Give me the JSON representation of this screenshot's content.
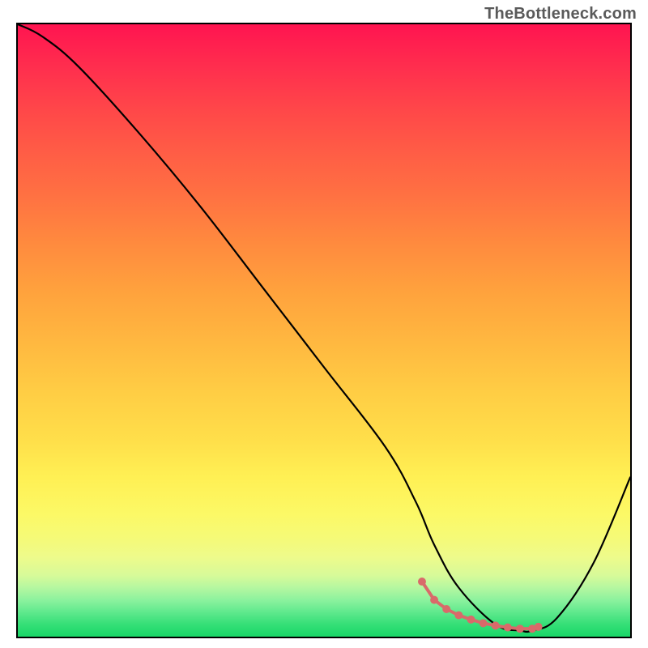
{
  "watermark": {
    "text": "TheBottleneck.com"
  },
  "chart_data": {
    "type": "line",
    "title": "",
    "xlabel": "",
    "ylabel": "",
    "xlim": [
      0,
      100
    ],
    "ylim": [
      0,
      100
    ],
    "series": [
      {
        "name": "curve",
        "x": [
          0,
          4,
          10,
          20,
          30,
          40,
          50,
          60,
          65,
          68,
          72,
          78,
          82,
          84,
          88,
          94,
          100
        ],
        "values": [
          100,
          98,
          93,
          82,
          70,
          57,
          44,
          31,
          22,
          15,
          8,
          2,
          1,
          1,
          3,
          12,
          26
        ]
      }
    ],
    "markers": {
      "name": "bottom-dots",
      "color": "#d96a6a",
      "x": [
        66,
        68,
        70,
        72,
        74,
        76,
        78,
        80,
        82,
        84,
        85
      ],
      "values": [
        9,
        6,
        4.5,
        3.5,
        2.8,
        2.2,
        1.8,
        1.5,
        1.3,
        1.3,
        1.6
      ]
    }
  }
}
